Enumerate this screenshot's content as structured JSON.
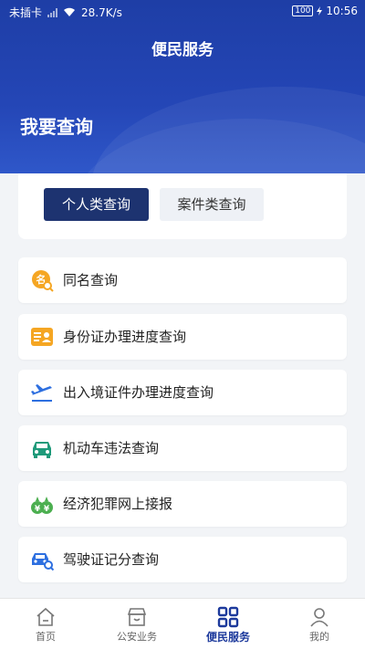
{
  "status_bar": {
    "carrier": "未插卡",
    "speed": "28.7K/s",
    "battery": "100",
    "time": "10:56"
  },
  "header": {
    "title": "便民服务",
    "section_title": "我要查询"
  },
  "tabs": [
    {
      "label": "个人类查询",
      "active": true
    },
    {
      "label": "案件类查询",
      "active": false
    }
  ],
  "query_items": [
    {
      "label": "同名查询",
      "icon": "name-search-icon"
    },
    {
      "label": "身份证办理进度查询",
      "icon": "id-card-icon"
    },
    {
      "label": "出入境证件办理进度查询",
      "icon": "airplane-icon"
    },
    {
      "label": "机动车违法查询",
      "icon": "car-icon"
    },
    {
      "label": "经济犯罪网上接报",
      "icon": "money-bags-icon"
    },
    {
      "label": "驾驶证记分查询",
      "icon": "car-search-icon"
    }
  ],
  "bottom_nav": [
    {
      "label": "首页",
      "icon": "home-icon",
      "active": false
    },
    {
      "label": "公安业务",
      "icon": "shop-icon",
      "active": false
    },
    {
      "label": "便民服务",
      "icon": "grid-icon",
      "active": true
    },
    {
      "label": "我的",
      "icon": "user-icon",
      "active": false
    }
  ],
  "colors": {
    "header_blue": "#2446b6",
    "active_tab": "#1d3370",
    "icon_orange": "#f5a623",
    "icon_blue": "#2d6fe0",
    "icon_green": "#4caf50",
    "icon_teal": "#1f9a7a",
    "nav_active": "#1d3a9c"
  }
}
